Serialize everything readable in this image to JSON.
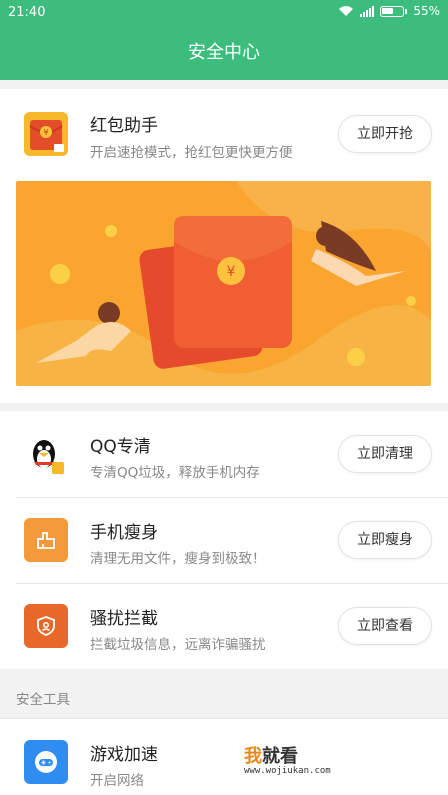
{
  "status_bar": {
    "time": "21:40",
    "battery": "55%"
  },
  "header": {
    "title": "安全中心"
  },
  "redpacket": {
    "title": "红包助手",
    "subtitle": "开启速抢模式，抢红包更快更方便",
    "button": "立即开抢",
    "icon": "red-envelope-icon",
    "currency_symbol": "¥"
  },
  "items": [
    {
      "title": "QQ专清",
      "subtitle": "专清QQ垃圾，释放手机内存",
      "button": "立即清理",
      "icon": "qq-penguin-icon"
    },
    {
      "title": "手机瘦身",
      "subtitle": "清理无用文件，瘦身到极致！",
      "button": "立即瘦身",
      "icon": "broom-icon"
    },
    {
      "title": "骚扰拦截",
      "subtitle": "拦截垃圾信息，远离诈骗骚扰",
      "button": "立即查看",
      "icon": "shield-icon"
    }
  ],
  "tools_section": {
    "label": "安全工具",
    "items": [
      {
        "title": "游戏加速",
        "subtitle": "开启网络",
        "icon": "gamepad-icon"
      }
    ]
  },
  "watermark": {
    "text_cn_1": "我",
    "text_cn_2": "就看",
    "url": "www.wojiukan.com"
  },
  "colors": {
    "primary": "#3dbd7d",
    "banner_bg": "#f9a52f",
    "envelope": "#e9502c",
    "icon_orange": "#f59a3b",
    "icon_red_orange": "#e8672a"
  }
}
